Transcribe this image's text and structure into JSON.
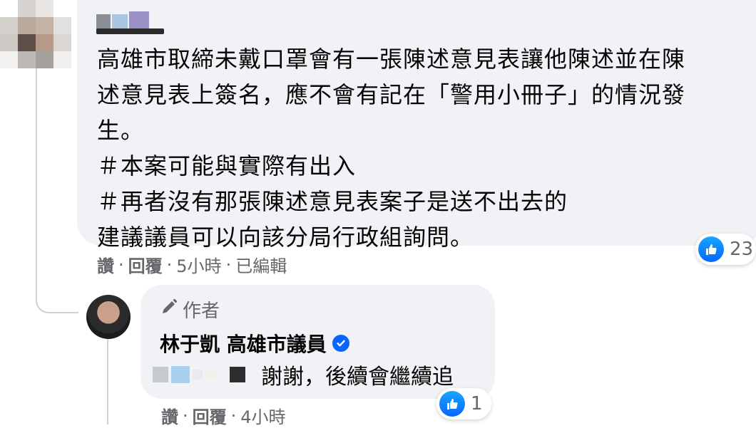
{
  "comment": {
    "author_name_redacted": "",
    "text_lines": [
      "高雄市取締未戴口罩會有一張陳述意見表讓他陳述並在陳",
      "述意見表上簽名，應不會有記在「警用小冊子」的情況發",
      "生。",
      "＃本案可能與實際有出入",
      "＃再者沒有那張陳述意見表案子是送不出去的",
      "建議議員可以向該分局行政組詢問。"
    ],
    "reaction_count": "23",
    "actions": {
      "like": "讚",
      "reply": "回覆",
      "time": "5小時",
      "edited": "已編輯"
    }
  },
  "reply": {
    "author_tag": "作者",
    "name": "林于凱 高雄市議員",
    "text": "謝謝，後續會繼續追",
    "reaction_count": "1",
    "actions": {
      "like": "讚",
      "reply": "回覆",
      "time": "4小時"
    }
  },
  "icons": {
    "like": "like-thumb-icon",
    "verified": "verified-badge-icon",
    "pencil": "pencil-icon"
  },
  "colors": {
    "bubble": "#f0f2f5",
    "like_blue": "#0866ff",
    "meta_gray": "#65676b"
  }
}
